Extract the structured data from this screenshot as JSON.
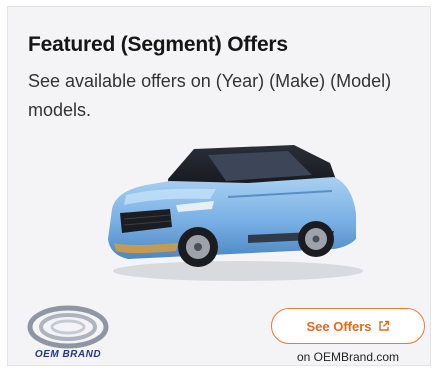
{
  "card": {
    "title": "Featured (Segment) Offers",
    "description": "See available offers on (Year) (Make) (Model) models.",
    "brand_name": "OEM BRAND",
    "cta_label": "See Offers",
    "cta_icon": "external-link-icon",
    "source_text": "on OEMBrand.com"
  },
  "colors": {
    "accent": "#e77a35",
    "brand": "#223a86",
    "car_body": "#7fb4e6"
  }
}
